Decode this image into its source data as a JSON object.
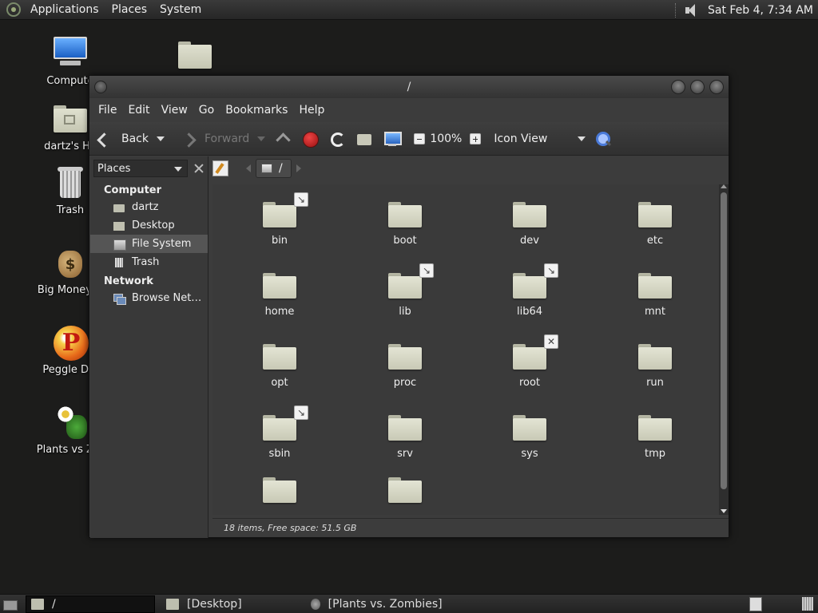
{
  "top_panel": {
    "menus": [
      "Applications",
      "Places",
      "System"
    ],
    "clock": "Sat Feb  4,  7:34 AM"
  },
  "desktop": {
    "icons": [
      {
        "label": "Compute",
        "icon": "computer-icon"
      },
      {
        "label": "dartz's Ho",
        "icon": "home-folder-icon"
      },
      {
        "label": "Trash",
        "icon": "trash-icon"
      },
      {
        "label": "Big Money D",
        "icon": "money-bag-icon"
      },
      {
        "label": "Peggle Del",
        "icon": "peggle-icon"
      },
      {
        "label": "Plants vs Zor",
        "icon": "plants-vs-zombies-icon"
      },
      {
        "label": "",
        "icon": "folder-icon"
      }
    ]
  },
  "window": {
    "title": "/",
    "menu": [
      "File",
      "Edit",
      "View",
      "Go",
      "Bookmarks",
      "Help"
    ],
    "toolbar": {
      "back": "Back",
      "forward": "Forward",
      "zoom": "100%",
      "view_mode": "Icon View"
    },
    "sidebar": {
      "selector": "Places",
      "groups": [
        {
          "name": "Computer",
          "items": [
            {
              "label": "dartz",
              "icon": "home-icon"
            },
            {
              "label": "Desktop",
              "icon": "desktop-icon"
            },
            {
              "label": "File System",
              "icon": "drive-icon",
              "selected": true
            },
            {
              "label": "Trash",
              "icon": "trash-icon"
            }
          ]
        },
        {
          "name": "Network",
          "items": [
            {
              "label": "Browse Net…",
              "icon": "network-icon"
            }
          ]
        }
      ]
    },
    "path": "/",
    "files": [
      {
        "name": "bin",
        "emblem": "link"
      },
      {
        "name": "boot",
        "emblem": ""
      },
      {
        "name": "dev",
        "emblem": ""
      },
      {
        "name": "etc",
        "emblem": ""
      },
      {
        "name": "home",
        "emblem": ""
      },
      {
        "name": "lib",
        "emblem": "link"
      },
      {
        "name": "lib64",
        "emblem": "link"
      },
      {
        "name": "mnt",
        "emblem": ""
      },
      {
        "name": "opt",
        "emblem": ""
      },
      {
        "name": "proc",
        "emblem": ""
      },
      {
        "name": "root",
        "emblem": "unreadable"
      },
      {
        "name": "run",
        "emblem": ""
      },
      {
        "name": "sbin",
        "emblem": "link"
      },
      {
        "name": "srv",
        "emblem": ""
      },
      {
        "name": "sys",
        "emblem": ""
      },
      {
        "name": "tmp",
        "emblem": ""
      },
      {
        "name": "",
        "emblem": ""
      },
      {
        "name": "",
        "emblem": ""
      }
    ],
    "status": "18 items, Free space: 51.5 GB"
  },
  "bottom_panel": {
    "tasks": [
      "/",
      "[Desktop]",
      "[Plants vs. Zombies]"
    ]
  }
}
